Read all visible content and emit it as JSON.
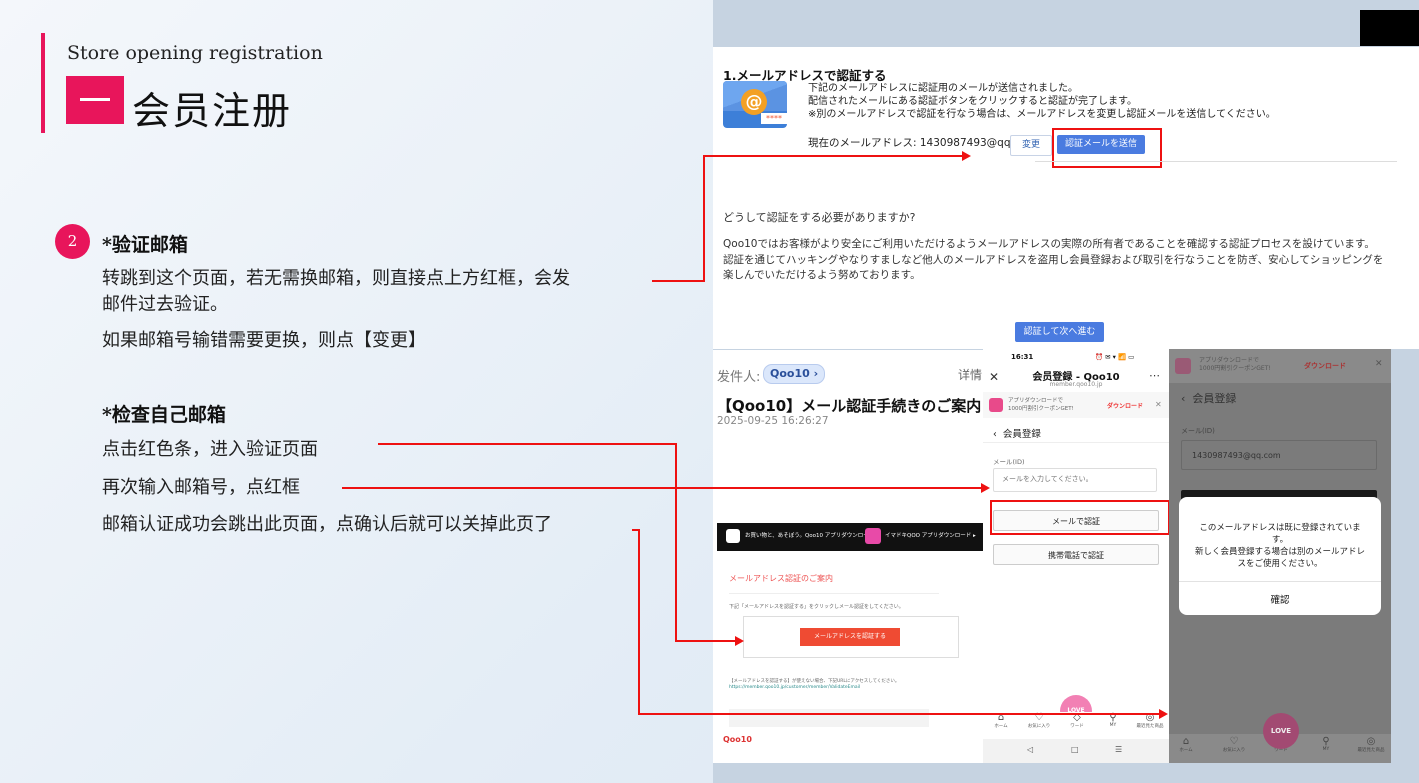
{
  "slide": {
    "subtitle": "Store opening registration",
    "title": "会员注册",
    "step_number": "2"
  },
  "left": {
    "section1_heading": "*验证邮箱",
    "section1_line1": "转跳到这个页面，若无需换邮箱，则直接点上方红框，会发",
    "section1_line2": "邮件过去验证。",
    "section1_line3": "如果邮箱号输错需要更换，则点【变更】",
    "section2_heading": "*检查自己邮箱",
    "section2_line1": "点击红色条，进入验证页面",
    "section2_line2": "再次输入邮箱号，点红框",
    "section2_line3": "邮箱认证成功会跳出此页面，点确认后就可以关掉此页了"
  },
  "verify_page": {
    "title": "1.メールアドレスで認証する",
    "line1": "下記のメールアドレスに認証用のメールが送信されました。",
    "line2": "配信されたメールにある認証ボタンをクリックすると認証が完了します。",
    "line3": "※別のメールアドレスで認証を行なう場合は、メールアドレスを変更し認証メールを送信してください。",
    "current_email": "現在のメールアドレス: 1430987493@qq.com",
    "change_button": "変更",
    "send_button": "認証メールを送信",
    "question": "どうして認証をする必要がありますか?",
    "body1": "Qoo10ではお客様がより安全にご利用いただけるようメールアドレスの実際の所有者であることを確認する認証プロセスを設けています。",
    "body2": "認証を通じてハッキングやなりすましなど他人のメールアドレスを盗用し会員登録および取引を行なうことを防ぎ、安心してショッピングを楽しんでいただけるよう努めております。",
    "next_button": "認証して次へ進む",
    "email_badge": "@",
    "pw_badge": "****"
  },
  "email": {
    "sender_label": "发件人:",
    "sender": "Qoo10",
    "detail": "详情",
    "subject": "【Qoo10】メール認証手続きのご案内",
    "date": "2025-09-25 16:26:27",
    "bar_text1": "お買い物と、あそぼう。Qoo10 アプリダウンロード ▸",
    "bar_text2": "イマドキQOO アプリダウンロード ▸",
    "heading": "メールアドレス認証のご案内",
    "small_text": "下記「メールアドレスを認証する」をクリックしメール認証をしてください。",
    "button": "メールアドレスを認証する",
    "link_text": "【メールアドレスを認証する】が使えない場合、下記URLにアクセスしてください。",
    "link_url": "https://member.qoo10.jp/customer/member/ValidateEmail",
    "footer_logo": "Qoo10"
  },
  "phone1": {
    "time": "16:31",
    "status_icons": "⏰ ✉ ▾ 📶 ▭",
    "header_title": "会员登録 - Qoo10",
    "url": "member.qoo10.jp",
    "banner_text1": "アプリダウンロードで",
    "banner_text2": "1000円割引クーポンGET!",
    "banner_download": "ダウンロード",
    "back_title": "会員登録",
    "email_label": "メール(ID)",
    "email_placeholder": "メールを入力してください。",
    "email_button": "メールで認証",
    "phone_button": "携帯電話で認証",
    "fab_label": "LOVE",
    "nav": [
      "ホーム",
      "お気に入り",
      "ワード",
      "MY",
      "最近見た商品"
    ],
    "nav_icons": [
      "⌂",
      "♡",
      "◇",
      "⚲",
      "◎"
    ],
    "sys_nav": [
      "◁",
      "□",
      "☰"
    ]
  },
  "phone2": {
    "banner_text1": "アプリダウンロードで",
    "banner_text2": "1000円割引クーポンGET!",
    "banner_download": "ダウンロード",
    "back_title": "会員登録",
    "email_label": "メール(ID)",
    "email_value": "1430987493@qq.com",
    "dialog_line1": "このメールアドレスは既に登録されていま",
    "dialog_line2": "す。",
    "dialog_line3": "新しく会員登録する場合は別のメールアドレ",
    "dialog_line4": "スをご使用ください。",
    "confirm": "確認",
    "fab_label": "LOVE",
    "nav": [
      "ホーム",
      "お気に入り",
      "ワード",
      "MY",
      "最近見た商品"
    ],
    "nav_icons": [
      "⌂",
      "♡",
      "◇",
      "⚲",
      "◎"
    ]
  }
}
